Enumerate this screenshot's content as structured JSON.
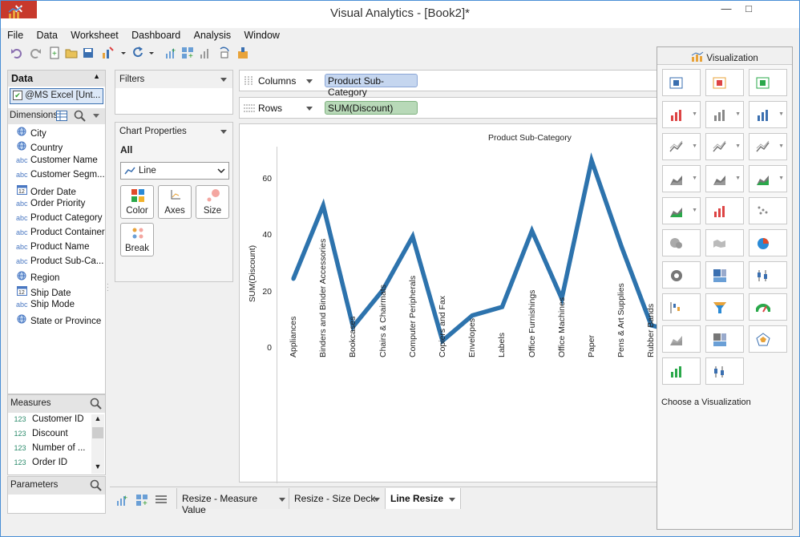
{
  "window": {
    "title": "Visual Analytics - [Book2]*",
    "minimize": "—",
    "maximize": "□",
    "close": "✕"
  },
  "menu": [
    "File",
    "Data",
    "Worksheet",
    "Dashboard",
    "Analysis",
    "Window"
  ],
  "data_pane": {
    "header": "Data",
    "source": "@MS Excel [Unt...",
    "dimensions_label": "Dimensions",
    "dimensions": [
      {
        "icon": "globe-icon",
        "label": "City"
      },
      {
        "icon": "globe-icon",
        "label": "Country"
      },
      {
        "icon": "abc",
        "label": "Customer Name"
      },
      {
        "icon": "abc",
        "label": "Customer Segm..."
      },
      {
        "icon": "calendar-icon",
        "label": "Order Date"
      },
      {
        "icon": "abc",
        "label": "Order Priority"
      },
      {
        "icon": "abc",
        "label": "Product Category"
      },
      {
        "icon": "abc",
        "label": "Product Container"
      },
      {
        "icon": "abc",
        "label": "Product Name"
      },
      {
        "icon": "abc",
        "label": "Product Sub-Ca..."
      },
      {
        "icon": "globe-icon",
        "label": "Region"
      },
      {
        "icon": "calendar-icon",
        "label": "Ship Date"
      },
      {
        "icon": "abc",
        "label": "Ship Mode"
      },
      {
        "icon": "globe-icon",
        "label": "State or Province"
      }
    ],
    "measures_label": "Measures",
    "measures": [
      {
        "icon": "123",
        "label": "Customer ID"
      },
      {
        "icon": "123",
        "label": "Discount"
      },
      {
        "icon": "x123",
        "label": "Number of ..."
      },
      {
        "icon": "123",
        "label": "Order ID"
      }
    ],
    "parameters_label": "Parameters"
  },
  "filters": {
    "label": "Filters"
  },
  "chart_properties": {
    "label": "Chart Properties",
    "tab": "All",
    "mark_type": "Line",
    "buttons": [
      "Color",
      "Axes",
      "Size",
      "Break"
    ]
  },
  "shelves": {
    "columns_label": "Columns",
    "columns_pill": "Product Sub-Category",
    "rows_label": "Rows",
    "rows_pill": "SUM(Discount)"
  },
  "tabs": [
    "Resize - Measure Value",
    "Resize - Size Deck",
    "Line Resize"
  ],
  "visualization": {
    "header": "Visualization",
    "choose_label": "Choose a Visualization",
    "icons": [
      "pivot-table-icon",
      "heat-map-icon",
      "highlight-table-icon",
      "bar-chart-icon",
      "side-by-side-bar-icon",
      "stacked-bar-icon",
      "line-chart-icon",
      "dual-line-icon",
      "discrete-line-icon",
      "area-chart-icon",
      "stacked-area-icon",
      "dual-area-icon",
      "combo-chart-icon",
      "histogram-bar-icon",
      "scatter-plot-icon",
      "symbol-map-icon",
      "filled-map-icon",
      "pie-chart-icon",
      "donut-chart-icon",
      "treemap-icon",
      "box-plot-icon",
      "waterfall-icon",
      "funnel-icon",
      "gauge-icon",
      "packed-area-icon",
      "packed-bubbles-icon",
      "radar-chart-icon",
      "histogram-icon",
      "candlestick-icon"
    ]
  },
  "colors": {
    "line": "#2d73ad",
    "columns_pill": "#c5d6ef",
    "rows_pill": "#b8d9b8",
    "close": "#c7392c"
  },
  "chart_data": {
    "type": "line",
    "title": "Product Sub-Category",
    "ylabel": "SUM(Discount)",
    "ylim": [
      0,
      70
    ],
    "yticks": [
      0,
      20,
      40,
      60
    ],
    "categories": [
      "Appliances",
      "Binders and Binder Accessories",
      "Bookcases",
      "Chairs & Chairmats",
      "Computer Peripherals",
      "Copiers and Fax",
      "Envelopes",
      "Labels",
      "Office Furnishings",
      "Office Machines",
      "Paper",
      "Pens & Art Supplies",
      "Rubber Bands"
    ],
    "series": [
      {
        "values": [
          24.5,
          50.5,
          7.5,
          20.5,
          39.5,
          2.5,
          11.5,
          14.5,
          41.5,
          17.5,
          66.5,
          36.0,
          8.0
        ]
      }
    ]
  }
}
